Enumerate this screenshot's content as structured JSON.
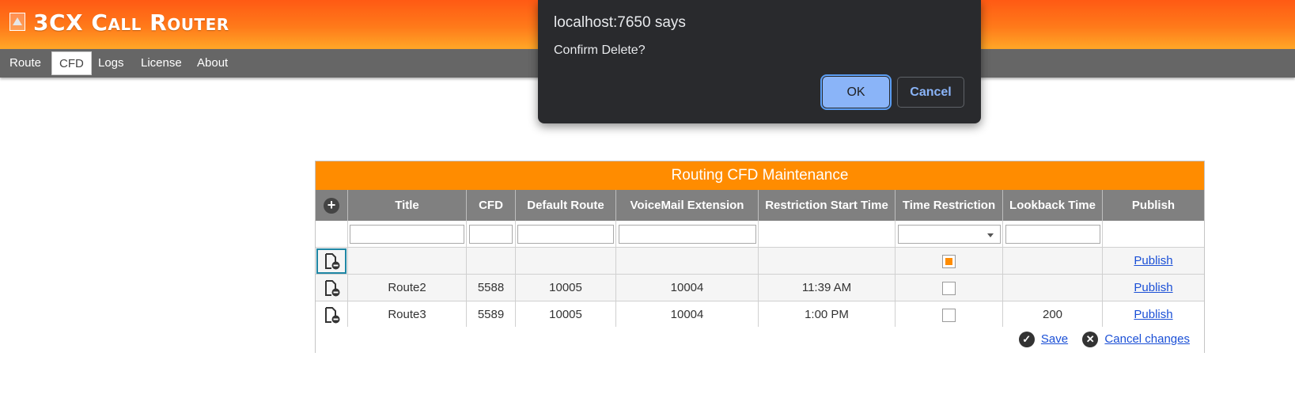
{
  "app": {
    "title": "3CX Call Router"
  },
  "nav": {
    "items": [
      {
        "label": "Route"
      },
      {
        "label": "CFD"
      },
      {
        "label": "Logs"
      },
      {
        "label": "License"
      },
      {
        "label": "About"
      }
    ],
    "active": "CFD"
  },
  "dialog": {
    "title": "localhost:7650 says",
    "message": "Confirm Delete?",
    "ok_label": "OK",
    "cancel_label": "Cancel"
  },
  "grid": {
    "caption": "Routing CFD Maintenance",
    "columns": [
      "Title",
      "CFD",
      "Default Route",
      "VoiceMail Extension",
      "Restriction Start Time",
      "Time Restriction",
      "Lookback Time",
      "Publish"
    ],
    "rows": [
      {
        "title": "",
        "cfd": "",
        "default_route": "",
        "voicemail": "",
        "start_time": "",
        "time_restriction": true,
        "lookback": "",
        "publish": "Publish"
      },
      {
        "title": "Route2",
        "cfd": "5588",
        "default_route": "10005",
        "voicemail": "10004",
        "start_time": "11:39 AM",
        "time_restriction": false,
        "lookback": "",
        "publish": "Publish"
      },
      {
        "title": "Route3",
        "cfd": "5589",
        "default_route": "10005",
        "voicemail": "10004",
        "start_time": "1:00 PM",
        "time_restriction": false,
        "lookback": "200",
        "publish": "Publish"
      }
    ],
    "footer": {
      "save_label": "Save",
      "cancel_label": "Cancel changes"
    }
  },
  "colors": {
    "header_orange": "#ff7a1a",
    "caption_orange": "#ff8c00",
    "nav_gray": "#666666",
    "column_header_gray": "#808080",
    "link_blue": "#1a4fd6",
    "dialog_bg": "#292a2d",
    "dialog_button_blue": "#8ab4f8"
  }
}
